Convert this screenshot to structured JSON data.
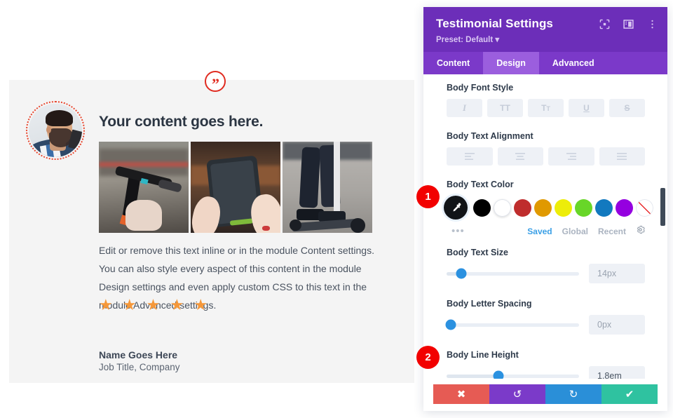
{
  "preview": {
    "quote_icon": "quote-mark-icon",
    "avatar_alt": "portrait-photo",
    "title": "Your content goes here.",
    "images": [
      "scooter-handlebar-photo",
      "phone-in-hands-photo",
      "legs-on-scooter-photo"
    ],
    "body": "Edit or remove this text inline or in the module Content settings. You can also style every aspect of this content in the module Design settings and even apply custom CSS to this text in the module Advanced settings.",
    "rating": "★ ★ ★ ★ ★",
    "rating_count": 5,
    "name": "Name Goes Here",
    "job": "Job Title, Company"
  },
  "panel": {
    "title": "Testimonial Settings",
    "preset": "Preset: Default ▾",
    "header_icons": [
      "focus-target-icon",
      "layout-panel-icon",
      "kebab-menu-icon"
    ],
    "tabs": [
      {
        "label": "Content",
        "active": false
      },
      {
        "label": "Design",
        "active": true
      },
      {
        "label": "Advanced",
        "active": false
      }
    ],
    "fields": {
      "font_style": {
        "label": "Body Font Style",
        "options": [
          {
            "name": "italic-button",
            "glyph": "I"
          },
          {
            "name": "uppercase-button",
            "glyph": "TT"
          },
          {
            "name": "small-caps-button",
            "glyph": "TT"
          },
          {
            "name": "underline-button",
            "glyph": "U"
          },
          {
            "name": "strikethrough-button",
            "glyph": "S"
          }
        ]
      },
      "text_alignment": {
        "label": "Body Text Alignment",
        "options": [
          "align-left",
          "align-center",
          "align-right",
          "align-justify"
        ]
      },
      "text_color": {
        "label": "Body Text Color",
        "picker": "eyedropper-icon",
        "swatches": [
          "#000000",
          "#ffffff",
          "#bf2d2d",
          "#e09900",
          "#eded09",
          "#68d628",
          "#1279bf",
          "#9500e0"
        ],
        "swatch_names": [
          "swatch-black",
          "swatch-white",
          "swatch-red",
          "swatch-orange",
          "swatch-yellow",
          "swatch-green",
          "swatch-blue",
          "swatch-purple",
          "swatch-transparent"
        ],
        "more": "•••",
        "links": [
          {
            "label": "Saved",
            "active": true
          },
          {
            "label": "Global",
            "active": false
          },
          {
            "label": "Recent",
            "active": false
          }
        ],
        "settings_icon": "gear-icon"
      },
      "text_size": {
        "label": "Body Text Size",
        "value": "14px",
        "position_pct": 11
      },
      "letter_spacing": {
        "label": "Body Letter Spacing",
        "value": "0px",
        "position_pct": 1
      },
      "line_height": {
        "label": "Body Line Height",
        "value": "1.8em",
        "position_pct": 39
      }
    },
    "footer": [
      {
        "name": "cancel-button",
        "glyph": "✖",
        "color": "#e65b54"
      },
      {
        "name": "undo-button",
        "glyph": "↺",
        "color": "#7b3ac9"
      },
      {
        "name": "redo-button",
        "glyph": "↻",
        "color": "#2a8fd8"
      },
      {
        "name": "save-button",
        "glyph": "✔",
        "color": "#2fc2a0"
      }
    ]
  },
  "badges": [
    {
      "label": "1",
      "name": "annotation-badge-1"
    },
    {
      "label": "2",
      "name": "annotation-badge-2"
    }
  ]
}
